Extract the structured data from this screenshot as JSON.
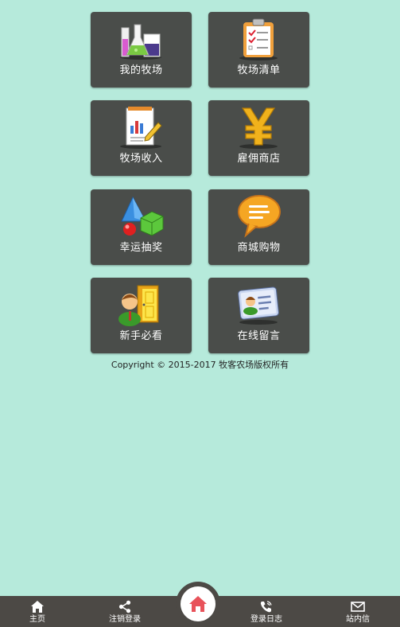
{
  "tiles": [
    {
      "label": "我的牧场",
      "icon": "lab-flask-icon"
    },
    {
      "label": "牧场清单",
      "icon": "clipboard-checklist-icon"
    },
    {
      "label": "牧场收入",
      "icon": "report-chart-icon"
    },
    {
      "label": "雇佣商店",
      "icon": "yen-icon"
    },
    {
      "label": "幸运抽奖",
      "icon": "shapes-lottery-icon"
    },
    {
      "label": "商城购物",
      "icon": "chat-bubble-icon"
    },
    {
      "label": "新手必看",
      "icon": "person-door-icon"
    },
    {
      "label": "在线留言",
      "icon": "contact-card-icon"
    }
  ],
  "copyright": "Copyright © 2015-2017 牧客农场版权所有",
  "bottom_nav": {
    "items": [
      {
        "label": "主页",
        "icon": "home-icon"
      },
      {
        "label": "注销登录",
        "icon": "share-icon"
      },
      {
        "label": "登录日志",
        "icon": "phone-icon"
      },
      {
        "label": "站内信",
        "icon": "mail-icon"
      }
    ],
    "center_icon": "home-icon",
    "accent_color": "#e8525a"
  },
  "colors": {
    "background": "#b6eadb",
    "tile": "#4a4d4a",
    "nav_bar": "#4c4945"
  }
}
